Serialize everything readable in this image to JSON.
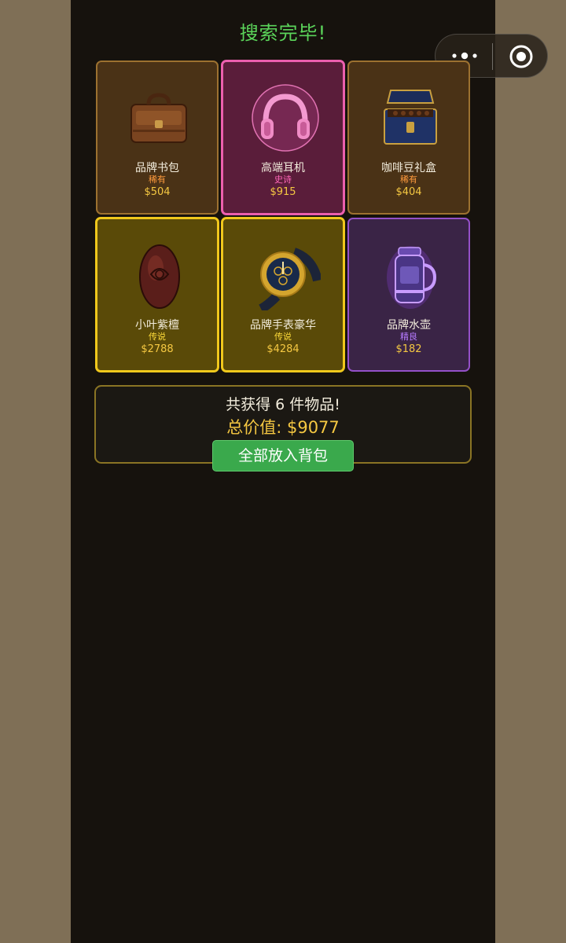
{
  "title": "搜索完毕!",
  "capsule": {
    "more_icon": "more-dots-icon",
    "close_icon": "target-circle-icon"
  },
  "items": [
    {
      "name": "品牌书包",
      "rarity": "稀有",
      "price": "$504",
      "icon": "briefcase-icon"
    },
    {
      "name": "高端耳机",
      "rarity": "史诗",
      "price": "$915",
      "icon": "headphones-icon"
    },
    {
      "name": "咖啡豆礼盒",
      "rarity": "稀有",
      "price": "$404",
      "icon": "gift-box-icon"
    },
    {
      "name": "小叶紫檀",
      "rarity": "传说",
      "price": "$2788",
      "icon": "carved-wood-icon"
    },
    {
      "name": "品牌手表豪华",
      "rarity": "传说",
      "price": "$4284",
      "icon": "watch-icon"
    },
    {
      "name": "品牌水壶",
      "rarity": "精良",
      "price": "$182",
      "icon": "flask-icon"
    }
  ],
  "summary": {
    "count_text": "共获得 6 件物品!",
    "total_text": "总价值: $9077",
    "button_label": "全部放入背包"
  },
  "colors": {
    "title": "#5bd45a",
    "rare": "#ff9a3c",
    "epic": "#ff67b8",
    "legendary": "#ffdc3a",
    "fine": "#b57aff",
    "price": "#f5c842",
    "button": "#3aa94c"
  }
}
